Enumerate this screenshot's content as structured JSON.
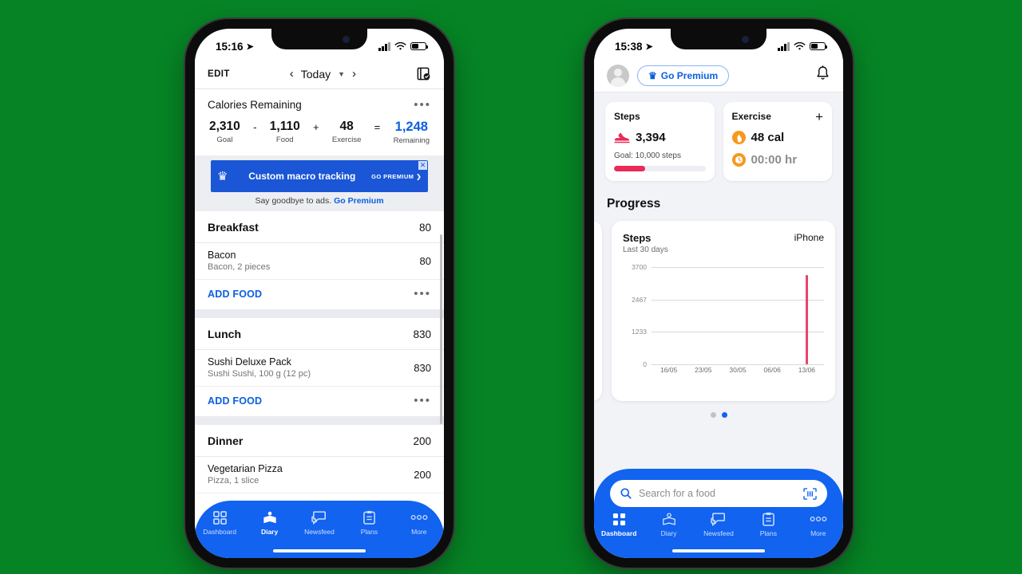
{
  "background_color": "#068425",
  "accent_blue": "#1163f0",
  "accent_pink": "#eb2a58",
  "accent_orange": "#f7981d",
  "left_phone": {
    "status_bar": {
      "time": "15:16",
      "location_icon": "location-arrow-icon"
    },
    "diary_nav": {
      "edit_label": "EDIT",
      "prev_icon": "chevron-left-icon",
      "date_label": "Today",
      "caret_icon": "caret-down-icon",
      "next_icon": "chevron-right-icon",
      "complete_icon": "complete-diary-icon"
    },
    "calories": {
      "title": "Calories Remaining",
      "more_icon": "more-horizontal-icon",
      "cells": [
        {
          "value": "2,310",
          "label": "Goal"
        },
        {
          "value": "1,110",
          "label": "Food"
        },
        {
          "value": "48",
          "label": "Exercise"
        },
        {
          "value": "1,248",
          "label": "Remaining"
        }
      ],
      "operators": [
        "-",
        "+",
        "="
      ]
    },
    "ad": {
      "crown_icon": "crown-icon",
      "headline": "Custom macro tracking",
      "cta": "GO PREMIUM",
      "cta_chevron": "chevron-right-icon",
      "close_icon": "close-icon",
      "subtext": "Say goodbye to ads.",
      "sub_link": "Go Premium"
    },
    "meals": [
      {
        "name": "Breakfast",
        "calories": "80",
        "foods": [
          {
            "title": "Bacon",
            "sub": "Bacon, 2 pieces",
            "calories": "80"
          }
        ],
        "add_label": "ADD FOOD",
        "more_icon": "more-horizontal-icon"
      },
      {
        "name": "Lunch",
        "calories": "830",
        "foods": [
          {
            "title": "Sushi Deluxe Pack",
            "sub": "Sushi Sushi, 100 g (12 pc)",
            "calories": "830"
          }
        ],
        "add_label": "ADD FOOD",
        "more_icon": "more-horizontal-icon"
      },
      {
        "name": "Dinner",
        "calories": "200",
        "foods": [
          {
            "title": "Vegetarian Pizza",
            "sub": "Pizza, 1 slice",
            "calories": "200"
          }
        ],
        "add_label": "ADD FOOD",
        "more_icon": "more-horizontal-icon"
      }
    ],
    "bottom_nav": {
      "active": "Diary",
      "items": [
        {
          "label": "Dashboard",
          "icon": "dashboard-grid-icon"
        },
        {
          "label": "Diary",
          "icon": "diary-book-icon"
        },
        {
          "label": "Newsfeed",
          "icon": "newsfeed-chat-icon"
        },
        {
          "label": "Plans",
          "icon": "plans-clipboard-icon"
        },
        {
          "label": "More",
          "icon": "more-dots-icon"
        }
      ]
    }
  },
  "right_phone": {
    "status_bar": {
      "time": "15:38",
      "location_icon": "location-arrow-icon"
    },
    "header": {
      "avatar": "user-avatar",
      "premium_label": "Go Premium",
      "premium_icon": "crown-icon",
      "bell_icon": "notification-bell-icon"
    },
    "cards": {
      "steps": {
        "title": "Steps",
        "icon": "running-shoe-icon",
        "value": "3,394",
        "goal_text": "Goal: 10,000 steps",
        "progress_percent": 34
      },
      "exercise": {
        "title": "Exercise",
        "add_icon": "plus-icon",
        "calories": "48 cal",
        "calories_icon": "flame-icon",
        "duration": "00:00 hr",
        "duration_icon": "clock-icon"
      }
    },
    "progress": {
      "section_title": "Progress",
      "pager": {
        "count": 2,
        "active_index": 1
      }
    },
    "search": {
      "placeholder": "Search for a food",
      "search_icon": "search-icon",
      "barcode_icon": "barcode-scan-icon"
    },
    "bottom_nav": {
      "active": "Dashboard",
      "items": [
        {
          "label": "Dashboard",
          "icon": "dashboard-grid-icon"
        },
        {
          "label": "Diary",
          "icon": "diary-book-icon"
        },
        {
          "label": "Newsfeed",
          "icon": "newsfeed-chat-icon"
        },
        {
          "label": "Plans",
          "icon": "plans-clipboard-icon"
        },
        {
          "label": "More",
          "icon": "more-dots-icon"
        }
      ]
    }
  },
  "chart_data": {
    "type": "bar",
    "title": "Steps",
    "subtitle": "Last 30 days",
    "source_label": "iPhone",
    "xlabel": "",
    "ylabel": "",
    "ylim": [
      0,
      3700
    ],
    "yticks": [
      0,
      1233,
      2467,
      3700
    ],
    "ytick_labels": [
      "0",
      "1233",
      "2467",
      "3700"
    ],
    "xtick_labels": [
      "16/05",
      "23/05",
      "30/05",
      "06/06",
      "13/06"
    ],
    "grid": true,
    "legend": "none",
    "categories": [
      "16/05",
      "23/05",
      "30/05",
      "06/06",
      "13/06"
    ],
    "values": [
      0,
      0,
      0,
      0,
      3394
    ],
    "bar_color": "#e8446b"
  }
}
